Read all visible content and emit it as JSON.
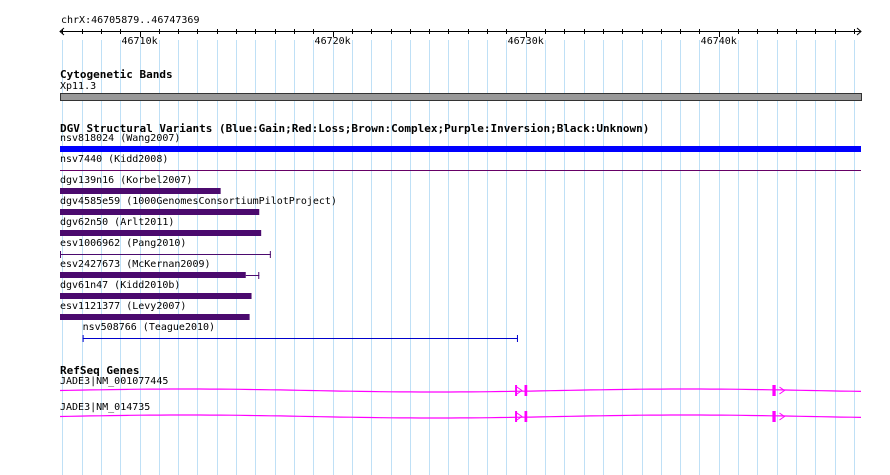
{
  "coordinate_range": "chrX:46705879..46747369",
  "ruler": {
    "start": 46705879,
    "end": 46747369,
    "ticks": [
      {
        "pos": 46710000,
        "label": "46710k"
      },
      {
        "pos": 46720000,
        "label": "46720k"
      },
      {
        "pos": 46730000,
        "label": "46730k"
      },
      {
        "pos": 46740000,
        "label": "46740k"
      }
    ]
  },
  "tracks": {
    "cytobands": {
      "title": "Cytogenetic Bands",
      "band": "Xp11.3",
      "color": "#999999"
    },
    "dgv": {
      "title": "DGV Structural Variants (Blue:Gain;Red:Loss;Brown:Complex;Purple:Inversion;Black:Unknown)",
      "features": [
        {
          "label": "nsv818024 (Wang2007)",
          "color": "#0000ff",
          "style": "thick",
          "start": 46705879,
          "end": 46747369
        },
        {
          "label": "nsv7440 (Kidd2008)",
          "color": "#660066",
          "style": "thin",
          "start": 46705879,
          "end": 46747369
        },
        {
          "label": "dgv139n16 (Korbel2007)",
          "color": "#4b0a6e",
          "style": "thick",
          "start": 46705879,
          "end": 46714200
        },
        {
          "label": "dgv4585e59 (1000GenomesConsortiumPilotProject)",
          "color": "#4b0a6e",
          "style": "thick",
          "start": 46705879,
          "end": 46716200
        },
        {
          "label": "dgv62n50 (Arlt2011)",
          "color": "#4b0a6e",
          "style": "thick",
          "start": 46705879,
          "end": 46716300
        },
        {
          "label": "esv1006962 (Pang2010)",
          "color": "#4b0a6e",
          "style": "capped",
          "start": 46705879,
          "end": 46716800
        },
        {
          "label": "esv2427673 (McKernan2009)",
          "color": "#4b0a6e",
          "style": "thick-capped",
          "start": 46705879,
          "end": 46715500,
          "cap_end": 46716200
        },
        {
          "label": "dgv61n47 (Kidd2010b)",
          "color": "#4b0a6e",
          "style": "thick",
          "start": 46705879,
          "end": 46715800
        },
        {
          "label": "esv1121377 (Levy2007)",
          "color": "#4b0a6e",
          "style": "thick",
          "start": 46705879,
          "end": 46715700
        },
        {
          "label": "nsv508766 (Teague2010)",
          "color": "#0000cc",
          "style": "capped",
          "start": 46707050,
          "end": 46729600
        }
      ]
    },
    "refseq": {
      "title": "RefSeq Genes",
      "color": "#ff00ff",
      "genes": [
        {
          "label": "JADE3|NM_001077445",
          "start": 46705879,
          "end": 46747369,
          "exons": [
            {
              "start": 46729450,
              "end": 46729550
            },
            {
              "start": 46729940,
              "end": 46730080
            },
            {
              "start": 46742780,
              "end": 46742950
            }
          ],
          "arrows": [
            46729700,
            46743300
          ]
        },
        {
          "label": "JADE3|NM_014735",
          "start": 46705879,
          "end": 46747369,
          "exons": [
            {
              "start": 46729450,
              "end": 46729550
            },
            {
              "start": 46729940,
              "end": 46730080
            },
            {
              "start": 46742780,
              "end": 46742950
            }
          ],
          "arrows": [
            46729700,
            46743300
          ]
        }
      ]
    }
  }
}
